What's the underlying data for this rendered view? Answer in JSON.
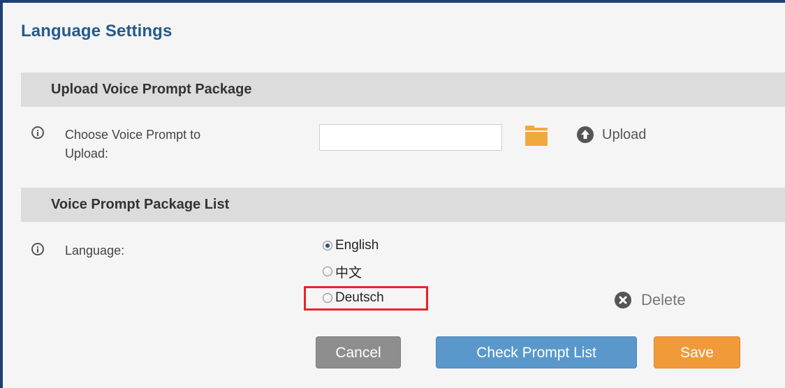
{
  "page": {
    "title": "Language Settings"
  },
  "upload_section": {
    "header": "Upload Voice Prompt Package",
    "field_label_line1": "Choose Voice Prompt to",
    "field_label_line2": "Upload:",
    "input_value": "",
    "folder_icon": "folder-icon",
    "upload_label": "Upload",
    "upload_icon": "upload-circle-icon"
  },
  "list_section": {
    "header": "Voice Prompt Package List",
    "field_label": "Language:",
    "options": [
      {
        "label": "English",
        "checked": true
      },
      {
        "label": "中文",
        "checked": false
      },
      {
        "label": "Deutsch",
        "checked": false
      }
    ],
    "delete_label": "Delete",
    "delete_icon": "delete-circle-icon"
  },
  "actions": {
    "cancel_label": "Cancel",
    "check_label": "Check Prompt List",
    "save_label": "Save"
  },
  "colors": {
    "title": "#245a8d",
    "frame_border": "#1d3f73",
    "section_header_bg": "#dcdcdc",
    "cancel": "#8e8e8e",
    "check": "#5a98cc",
    "save": "#f19a3a",
    "folder": "#f0a93d",
    "highlight": "#e8232b"
  }
}
